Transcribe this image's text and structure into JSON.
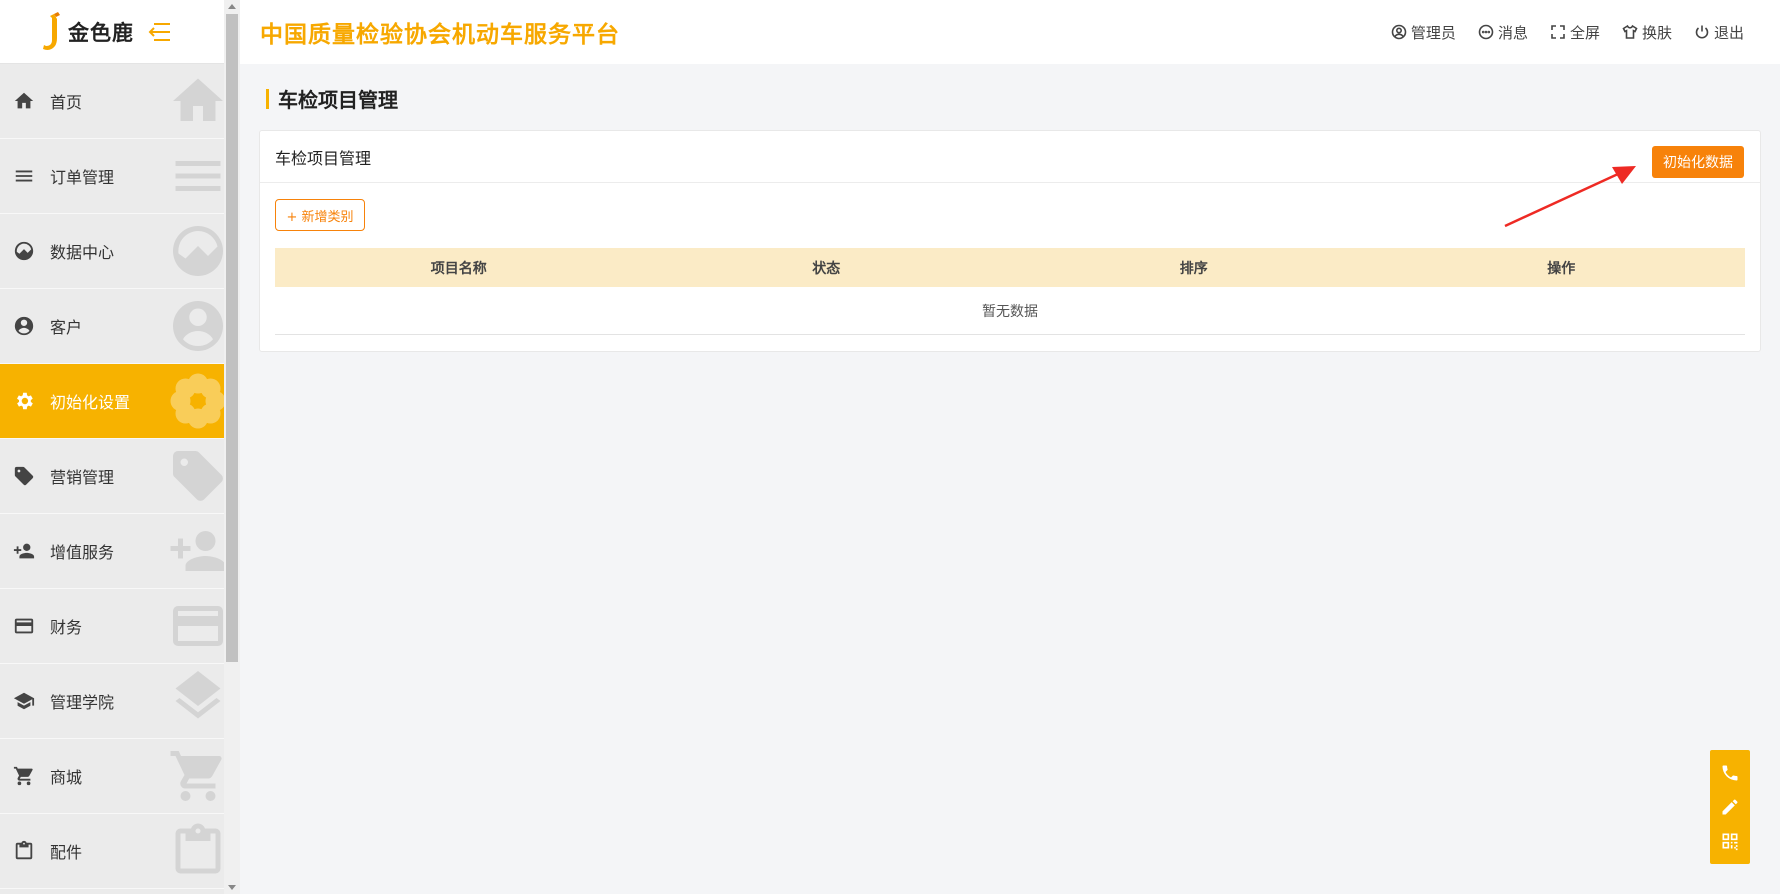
{
  "logo": {
    "text": "金色鹿"
  },
  "sidebar": {
    "items": [
      {
        "label": "首页",
        "icon": "home-icon",
        "active": false
      },
      {
        "label": "订单管理",
        "icon": "list-icon",
        "active": false
      },
      {
        "label": "数据中心",
        "icon": "chart-icon",
        "active": false
      },
      {
        "label": "客户",
        "icon": "user-icon",
        "active": false
      },
      {
        "label": "初始化设置",
        "icon": "gear-icon",
        "active": true
      },
      {
        "label": "营销管理",
        "icon": "tag-icon",
        "active": false
      },
      {
        "label": "增值服务",
        "icon": "add-user-icon",
        "active": false
      },
      {
        "label": "财务",
        "icon": "card-icon",
        "active": false
      },
      {
        "label": "管理学院",
        "icon": "graduation-icon",
        "active": false
      },
      {
        "label": "商城",
        "icon": "cart-icon",
        "active": false
      },
      {
        "label": "配件",
        "icon": "clipboard-icon",
        "active": false
      }
    ]
  },
  "header": {
    "title": "中国质量检验协会机动车服务平台",
    "actions": {
      "admin": "管理员",
      "messages": "消息",
      "fullscreen": "全屏",
      "skin": "换肤",
      "logout": "退出"
    }
  },
  "main": {
    "heading": "车检项目管理",
    "card": {
      "title": "车检项目管理",
      "init_button": "初始化数据",
      "add_button": "+ 新增类别",
      "table": {
        "columns": [
          "项目名称",
          "状态",
          "排序",
          "操作"
        ],
        "rows": [],
        "empty_text": "暂无数据"
      }
    }
  },
  "colors": {
    "accent": "#f7b200",
    "title": "#f7a800",
    "button": "#f7820a",
    "table_header": "#fbebc6",
    "annotation_arrow": "#ee2a24"
  }
}
